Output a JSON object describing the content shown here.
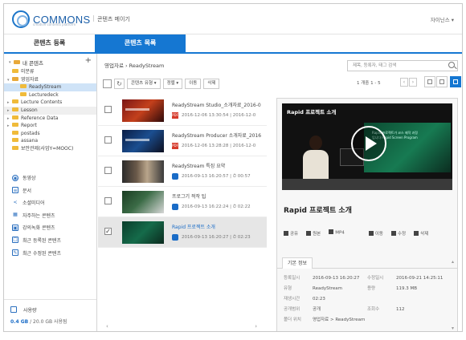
{
  "header": {
    "logo_text": "COMMONS",
    "logo_sub": "creative contents platform",
    "app_title": "콘텐츠 메이기",
    "user_menu": "자이닌스 ▾"
  },
  "tabs": [
    {
      "label": "콘텐츠 등록"
    },
    {
      "label": "콘텐츠 목록"
    }
  ],
  "sidebar": {
    "root_label": "내 콘텐츠",
    "add_label": "+",
    "tree": [
      {
        "label": "미분류"
      },
      {
        "label": "영업자료"
      },
      {
        "label": "ReadyStream"
      },
      {
        "label": "Lecturedeck"
      },
      {
        "label": "Lecture Contents"
      },
      {
        "label": "Lesson"
      },
      {
        "label": "Reference Data"
      },
      {
        "label": "Report"
      },
      {
        "label": "postads"
      },
      {
        "label": "assana"
      },
      {
        "label": "보안관제(사업Y=MOOC)"
      }
    ],
    "menu": [
      {
        "label": "동영상",
        "icon": "◉"
      },
      {
        "label": "문서",
        "icon": "≡"
      },
      {
        "label": "소셜미디어",
        "icon": "<"
      },
      {
        "label": "자주하는 콘텐츠",
        "icon": "▦"
      },
      {
        "label": "강의녹화 콘텐츠",
        "icon": "▣"
      },
      {
        "label": "최근 등록된 콘텐츠",
        "icon": "☐"
      },
      {
        "label": "최근 수정된 콘텐츠",
        "icon": "✎"
      }
    ],
    "storage_label": "사용량",
    "storage_used": "0.4 GB",
    "storage_total": " / 20.0 GB 사용됨"
  },
  "middle": {
    "breadcrumb": "영업자료  ›  ReadyStream",
    "toolbar": {
      "type_label": "콘텐츠 유형  ▾",
      "sort_label": "정렬  ▾",
      "move_label": "이동",
      "delete_label": "삭제"
    },
    "rows": [
      {
        "title": "ReadyStream Studio_소개자료_2016-0",
        "meta": "2016-12-06 13:30:54  |  2016-12-0",
        "kind": "pdf",
        "checked": ""
      },
      {
        "title": "ReadyStream Producer 소개자료_2016",
        "meta": "2016-12-06 13:28:28  |  2016-12-0",
        "kind": "pdf",
        "checked": ""
      },
      {
        "title": "ReadyStream 특징 요약",
        "meta": "2016-09-13 16:20:57  |  ⏱ 00:57",
        "kind": "video",
        "checked": ""
      },
      {
        "title": "프로그기 적작 팁",
        "meta": "2016-09-13 16:22:24  |  ⏱ 02:22",
        "kind": "video",
        "checked": ""
      },
      {
        "title": "Rapid 프로젝트 소개",
        "meta": "2016-09-13 16:20:27  |  ⏱ 02:23",
        "kind": "video",
        "checked": "✓"
      }
    ]
  },
  "right": {
    "search_placeholder": "제목, 등록자, 태그 검색",
    "pager_text": "1 개중 1 - 5",
    "video_title": "Rapid 프로젝트 소개",
    "screen_text": "Rapid 프로젝트가\n코스 제작 과정입니다\nRapid Screen Program",
    "detail_title": "Rapid 프로젝트 소개",
    "actions": {
      "share": "공유",
      "download": "원본",
      "mp4": "MP4",
      "move": "이동",
      "edit": "수정",
      "delete": "삭제"
    },
    "info_tab": "기본 정보",
    "info": [
      {
        "k": "등록일시",
        "v": "2016-09-13 16:20:27",
        "k2": "수정일시",
        "v2": "2016-09-21 14:25:11"
      },
      {
        "k": "유형",
        "v": "ReadyStream",
        "k2": "용량",
        "v2": "119.3 MB"
      },
      {
        "k": "재생시간",
        "v": "02:23",
        "k2": "",
        "v2": ""
      },
      {
        "k": "공개범위",
        "v": "공개",
        "k2": "조회수",
        "v2": "112"
      },
      {
        "k": "폴더 위치",
        "v": "영업자료 > ReadyStream",
        "k2": "",
        "v2": ""
      }
    ]
  },
  "colors": {
    "accent": "#1577d2",
    "link": "#1a6cc7"
  }
}
